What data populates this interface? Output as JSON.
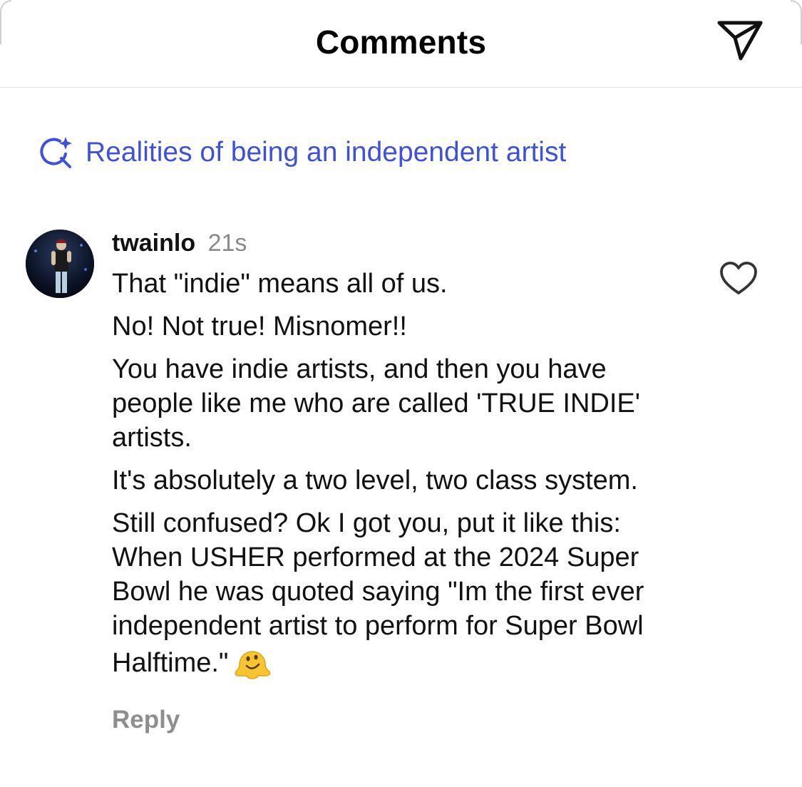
{
  "header": {
    "title": "Comments"
  },
  "ai_search": {
    "label": "Realities of being an independent artist",
    "icon": "ai-search-sparkle-icon",
    "color": "#3f51d8"
  },
  "comment": {
    "username": "twainlo",
    "timestamp": "21s",
    "paragraphs": [
      "That \"indie\" means all of us.",
      "No! Not true! Misnomer!!",
      "You have indie artists, and then you have people like me who are called 'TRUE INDIE' artists.",
      "It's absolutely a two level, two class system.",
      "Still confused? Ok I got you, put it like this: When USHER performed at the 2024 Super Bowl he was quoted saying \"Im the first ever independent artist to perform for Super Bowl Halftime.\""
    ],
    "emoji": "melting-face-emoji",
    "reply_label": "Reply",
    "like_icon": "heart-outline-icon"
  }
}
